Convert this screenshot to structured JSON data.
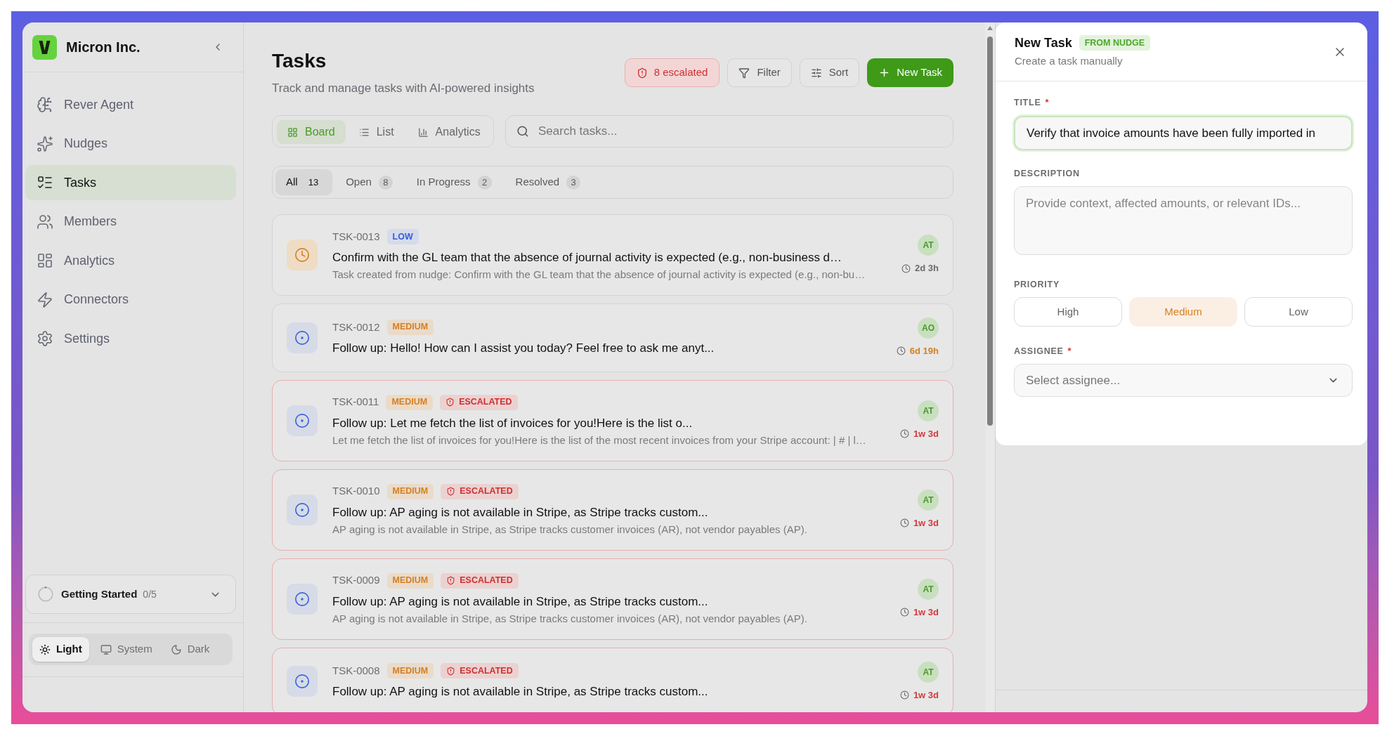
{
  "sidebar": {
    "brand": "Micron Inc.",
    "nav": [
      {
        "label": "Rever Agent",
        "selected": false
      },
      {
        "label": "Nudges",
        "selected": false
      },
      {
        "label": "Tasks",
        "selected": true
      },
      {
        "label": "Members",
        "selected": false
      },
      {
        "label": "Analytics",
        "selected": false
      },
      {
        "label": "Connectors",
        "selected": false
      },
      {
        "label": "Settings",
        "selected": false
      }
    ],
    "getting_started": {
      "label": "Getting Started",
      "progress": "0/5"
    },
    "theme": [
      {
        "label": "Light",
        "selected": true
      },
      {
        "label": "System",
        "selected": false
      },
      {
        "label": "Dark",
        "selected": false
      }
    ]
  },
  "header": {
    "title": "Tasks",
    "subtitle": "Track and manage tasks with AI-powered insights",
    "escalated_button": "8 escalated",
    "filter_button": "Filter",
    "sort_button": "Sort",
    "new_button": "New Task"
  },
  "views": [
    {
      "label": "Board",
      "selected": true
    },
    {
      "label": "List",
      "selected": false
    },
    {
      "label": "Analytics",
      "selected": false
    }
  ],
  "search": {
    "placeholder": "Search tasks..."
  },
  "status_tabs": [
    {
      "label": "All",
      "count": "13",
      "selected": true
    },
    {
      "label": "Open",
      "count": "8",
      "selected": false
    },
    {
      "label": "In Progress",
      "count": "2",
      "selected": false
    },
    {
      "label": "Resolved",
      "count": "3",
      "selected": false
    }
  ],
  "tasks": [
    {
      "id": "TSK-0013",
      "kind": "in_progress",
      "priority": {
        "label": "LOW",
        "kind": "low"
      },
      "escalated": false,
      "title": "Confirm with the GL team that the absence of journal activity is expected (e.g., non-business d…",
      "description": "Task created from nudge: Confirm with the GL team that the absence of journal activity is expected (e.g., non-bu…",
      "assignee": "AT",
      "age": {
        "text": "2d 3h",
        "color": "#6b6b6b"
      }
    },
    {
      "id": "TSK-0012",
      "kind": "open",
      "priority": {
        "label": "MEDIUM",
        "kind": "medium"
      },
      "escalated": false,
      "title": "Follow up: Hello! How can I assist you today? Feel free to ask me anyt...",
      "assignee": "AO",
      "age": {
        "text": "6d 19h",
        "color": "#d67f22"
      }
    },
    {
      "id": "TSK-0011",
      "kind": "open",
      "priority": {
        "label": "MEDIUM",
        "kind": "medium"
      },
      "escalated": true,
      "escalated_label": "ESCALATED",
      "title": "Follow up: Let me fetch the list of invoices for you!Here is the list o...",
      "description": "Let me fetch the list of invoices for you!Here is the list of the most recent invoices from your Stripe account: | # | l…",
      "assignee": "AT",
      "age": {
        "text": "1w 3d",
        "color": "#d33a3a"
      }
    },
    {
      "id": "TSK-0010",
      "kind": "open",
      "priority": {
        "label": "MEDIUM",
        "kind": "medium"
      },
      "escalated": true,
      "escalated_label": "ESCALATED",
      "title": "Follow up: AP aging is not available in Stripe, as Stripe tracks custom...",
      "description": "AP aging is not available in Stripe, as Stripe tracks customer invoices (AR), not vendor payables (AP).",
      "assignee": "AT",
      "age": {
        "text": "1w 3d",
        "color": "#d33a3a"
      }
    },
    {
      "id": "TSK-0009",
      "kind": "open",
      "priority": {
        "label": "MEDIUM",
        "kind": "medium"
      },
      "escalated": true,
      "escalated_label": "ESCALATED",
      "title": "Follow up: AP aging is not available in Stripe, as Stripe tracks custom...",
      "description": "AP aging is not available in Stripe, as Stripe tracks customer invoices (AR), not vendor payables (AP).",
      "assignee": "AT",
      "age": {
        "text": "1w 3d",
        "color": "#d33a3a"
      }
    },
    {
      "id": "TSK-0008",
      "kind": "open",
      "priority": {
        "label": "MEDIUM",
        "kind": "medium"
      },
      "escalated": true,
      "escalated_label": "ESCALATED",
      "title": "Follow up: AP aging is not available in Stripe, as Stripe tracks custom...",
      "assignee": "AT",
      "age": {
        "text": "1w 3d",
        "color": "#d33a3a"
      }
    }
  ],
  "new_task": {
    "title": "New Task",
    "badge": "FROM NUDGE",
    "subtitle": "Create a task manually",
    "title_field": {
      "label": "TITLE",
      "required_mark": "*",
      "value": "Verify that invoice amounts have been fully imported in",
      "focused": true
    },
    "description_field": {
      "label": "DESCRIPTION",
      "placeholder": "Provide context, affected amounts, or relevant IDs..."
    },
    "priority": {
      "label": "PRIORITY",
      "options": [
        {
          "label": "High",
          "selected": false
        },
        {
          "label": "Medium",
          "selected": true
        },
        {
          "label": "Low",
          "selected": false
        }
      ]
    },
    "assignee_field": {
      "label": "ASSIGNEE",
      "required_mark": "*",
      "placeholder": "Select assignee..."
    }
  }
}
